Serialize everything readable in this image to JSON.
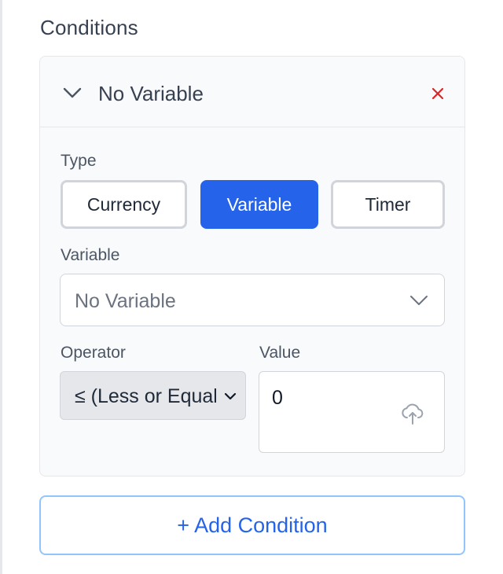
{
  "section": {
    "title": "Conditions"
  },
  "condition": {
    "header_title": "No Variable",
    "type_label": "Type",
    "type_options": [
      "Currency",
      "Variable",
      "Timer"
    ],
    "selected_type": "Variable",
    "variable_label": "Variable",
    "variable_value": "No Variable",
    "operator_label": "Operator",
    "operator_value": "≤ (Less or Equal)",
    "value_label": "Value",
    "value": "0"
  },
  "actions": {
    "add_condition": "+ Add Condition"
  },
  "colors": {
    "accent": "#2563eb",
    "remove": "#dc2626",
    "card_bg": "#f9fafb",
    "border": "#d1d5db"
  },
  "icons": {
    "collapse": "chevron-down-icon",
    "remove": "close-icon",
    "dropdown": "chevron-down-icon",
    "upload": "cloud-upload-icon"
  }
}
